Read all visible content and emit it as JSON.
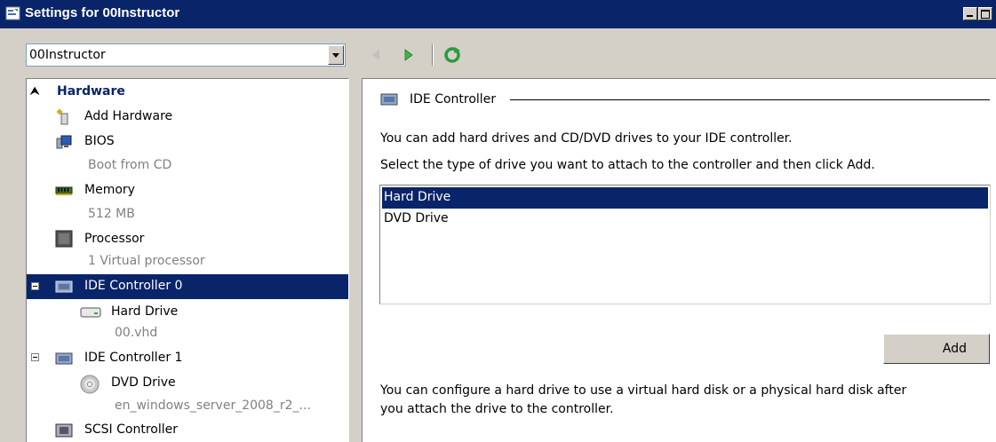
{
  "window": {
    "title": "Settings for 00Instructor"
  },
  "vm_selector": {
    "value": "00Instructor"
  },
  "tree": {
    "hardware_header": "Hardware",
    "items": [
      {
        "label": "Add Hardware"
      },
      {
        "label": "BIOS",
        "sub": "Boot from CD"
      },
      {
        "label": "Memory",
        "sub": "512 MB"
      },
      {
        "label": "Processor",
        "sub": "1 Virtual processor"
      },
      {
        "label": "IDE Controller 0"
      },
      {
        "label": "Hard Drive",
        "sub": "00.vhd"
      },
      {
        "label": "IDE Controller 1"
      },
      {
        "label": "DVD Drive",
        "sub": "en_windows_server_2008_r2_..."
      },
      {
        "label": "SCSI Controller"
      }
    ]
  },
  "details": {
    "section_title": "IDE Controller",
    "intro": "You can add hard drives and CD/DVD drives to your IDE controller.",
    "instruction": "Select the type of drive you want to attach to the controller and then click Add.",
    "drive_types": [
      "Hard Drive",
      "DVD Drive"
    ],
    "selected_drive_type": "Hard Drive",
    "add_label": "Add",
    "footer_line1": "You can configure a hard drive to use a virtual hard disk or a physical hard disk after",
    "footer_line2": "you attach the drive to the controller."
  },
  "colors": {
    "selection": "#0a246a",
    "face": "#d4d0c8"
  }
}
